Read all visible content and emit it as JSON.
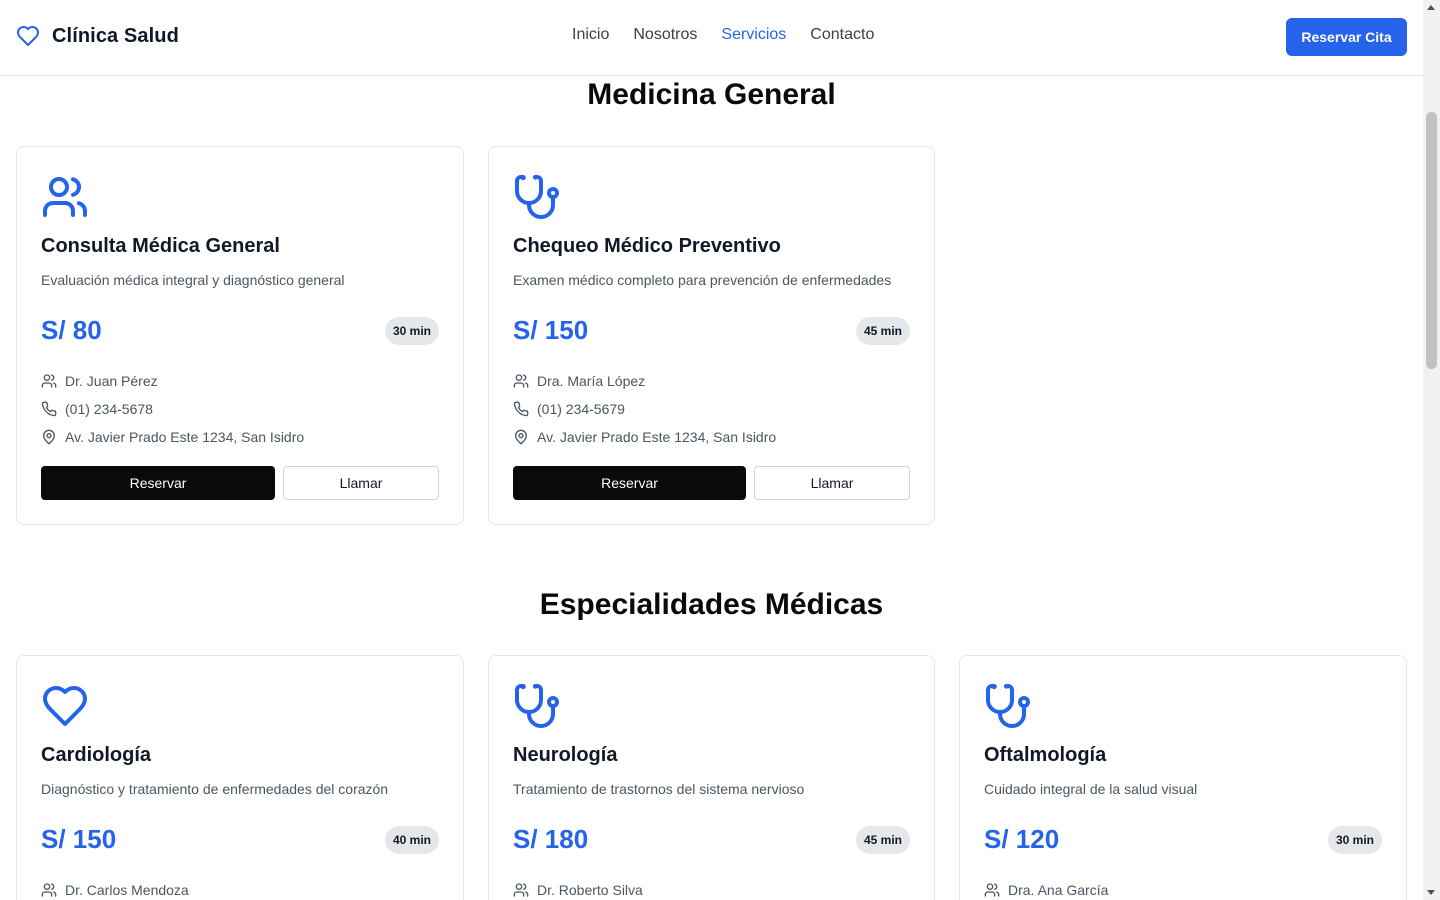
{
  "header": {
    "brand": "Clínica Salud",
    "nav": [
      "Inicio",
      "Nosotros",
      "Servicios",
      "Contacto"
    ],
    "active_nav": "Servicios",
    "cta": "Reservar Cita"
  },
  "colors": {
    "accent": "#2563eb",
    "dark_button": "#0a0a0a",
    "badge_bg": "#e5e7eb"
  },
  "sections": [
    {
      "title": "Medicina General",
      "cards": [
        {
          "icon": "users-icon",
          "title": "Consulta Médica General",
          "description": "Evaluación médica integral y diagnóstico general",
          "price": "S/ 80",
          "duration": "30 min",
          "doctor": "Dr. Juan Pérez",
          "phone": "(01) 234-5678",
          "address": "Av. Javier Prado Este 1234, San Isidro",
          "reserve": "Reservar",
          "call": "Llamar"
        },
        {
          "icon": "stethoscope-icon",
          "title": "Chequeo Médico Preventivo",
          "description": "Examen médico completo para prevención de enfermedades",
          "price": "S/ 150",
          "duration": "45 min",
          "doctor": "Dra. María López",
          "phone": "(01) 234-5679",
          "address": "Av. Javier Prado Este 1234, San Isidro",
          "reserve": "Reservar",
          "call": "Llamar"
        }
      ]
    },
    {
      "title": "Especialidades Médicas",
      "cards": [
        {
          "icon": "heart-icon",
          "title": "Cardiología",
          "description": "Diagnóstico y tratamiento de enfermedades del corazón",
          "price": "S/ 150",
          "duration": "40 min",
          "doctor": "Dr. Carlos Mendoza"
        },
        {
          "icon": "stethoscope-icon",
          "title": "Neurología",
          "description": "Tratamiento de trastornos del sistema nervioso",
          "price": "S/ 180",
          "duration": "45 min",
          "doctor": "Dr. Roberto Silva"
        },
        {
          "icon": "stethoscope-icon",
          "title": "Oftalmología",
          "description": "Cuidado integral de la salud visual",
          "price": "S/ 120",
          "duration": "30 min",
          "doctor": "Dra. Ana García"
        }
      ]
    }
  ]
}
